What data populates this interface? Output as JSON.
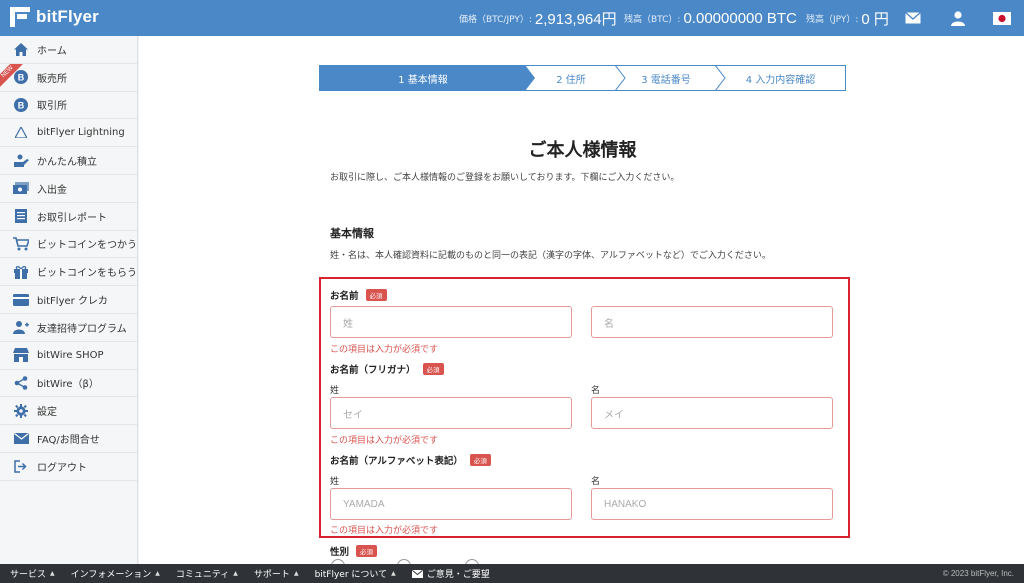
{
  "header": {
    "logo_text": "bitFlyer",
    "price_label": "価格（BTC/JPY）:",
    "price_value": "2,913,964円",
    "btc_balance_label": "残高（BTC）:",
    "btc_balance_value": "0.00000000 BTC",
    "jpy_balance_label": "残高（JPY）:",
    "jpy_balance_value": "0 円",
    "icons": [
      "mail-icon",
      "user-icon",
      "japan-flag-icon"
    ]
  },
  "sidebar": {
    "items": [
      {
        "label": "ホーム",
        "icon": "home-icon"
      },
      {
        "label": "販売所",
        "icon": "bitcoin-icon",
        "badge": "NEW"
      },
      {
        "label": "取引所",
        "icon": "bitcoin-icon"
      },
      {
        "label": "bitFlyer Lightning",
        "icon": "lightning-icon"
      },
      {
        "label": "かんたん積立",
        "icon": "savings-icon"
      },
      {
        "label": "入出金",
        "icon": "money-icon"
      },
      {
        "label": "お取引レポート",
        "icon": "report-icon"
      },
      {
        "label": "ビットコインをつかう",
        "icon": "cart-icon"
      },
      {
        "label": "ビットコインをもらう",
        "icon": "gift-icon"
      },
      {
        "label": "bitFlyer クレカ",
        "icon": "credit-card-icon"
      },
      {
        "label": "友達招待プログラム",
        "icon": "invite-icon"
      },
      {
        "label": "bitWire SHOP",
        "icon": "shop-icon"
      },
      {
        "label": "bitWire（β）",
        "icon": "share-icon"
      },
      {
        "label": "設定",
        "icon": "gear-icon"
      },
      {
        "label": "FAQ/お問合せ",
        "icon": "mail-icon"
      },
      {
        "label": "ログアウト",
        "icon": "logout-icon"
      }
    ]
  },
  "steps": [
    "1 基本情報",
    "2 住所",
    "3 電話番号",
    "4 入力内容確認"
  ],
  "page": {
    "title": "ご本人様情報",
    "description": "お取引に際し、ご本人様情報のご登録をお願いしております。下欄にご入力ください。",
    "section_title": "基本情報",
    "section_description": "姓・名は、本人確認資料に記載のものと同一の表記（漢字の字体、アルファベットなど）でご入力ください。"
  },
  "form": {
    "required_badge": "必須",
    "error_text": "この項目は入力が必須です",
    "name": {
      "label": "お名前",
      "last_placeholder": "姓",
      "first_placeholder": "名"
    },
    "kana": {
      "label": "お名前（フリガナ）",
      "last_label": "姓",
      "first_label": "名",
      "last_placeholder": "セイ",
      "first_placeholder": "メイ"
    },
    "alpha": {
      "label": "お名前（アルファベット表記）",
      "last_label": "姓",
      "first_label": "名",
      "last_placeholder": "YAMADA",
      "first_placeholder": "HANAKO"
    },
    "gender": {
      "label": "性別"
    }
  },
  "footer": {
    "items": [
      "サービス",
      "インフォメーション",
      "コミュニティ",
      "サポート",
      "bitFlyer について"
    ],
    "feedback": "ご意見・ご要望",
    "copyright": "© 2023 bitFlyer, Inc."
  },
  "colors": {
    "header_bg": "#4a88c8",
    "error_red": "#d9534f",
    "highlight_border": "#d9232e",
    "footer_bg": "#2f3337"
  }
}
